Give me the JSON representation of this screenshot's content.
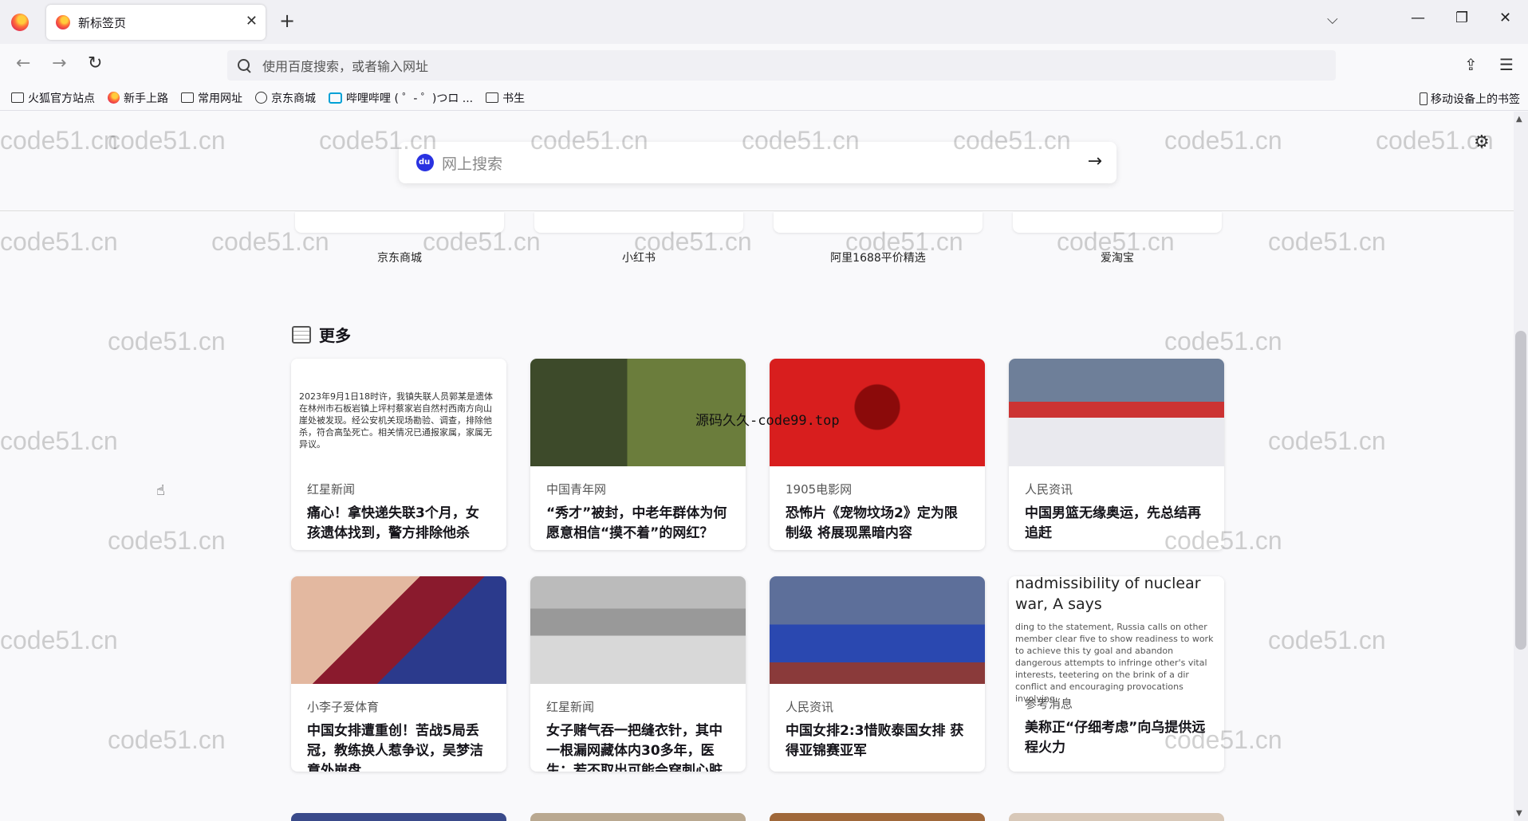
{
  "tab": {
    "title": "新标签页",
    "close": "✕"
  },
  "tabstrip": {
    "new_tab": "+",
    "tab_list": "⌵",
    "minimize": "—",
    "restore": "❐",
    "close": "✕"
  },
  "navbar": {
    "back": "←",
    "forward": "→",
    "reload": "↻",
    "url_placeholder": "使用百度搜索，或者输入网址",
    "extensions": "⇪",
    "menu": "☰"
  },
  "bookmarks": [
    {
      "label": "火狐官方站点",
      "icon": "folder-icon"
    },
    {
      "label": "新手上路",
      "icon": "firefox-icon"
    },
    {
      "label": "常用网址",
      "icon": "folder-icon"
    },
    {
      "label": "京东商城",
      "icon": "globe-icon"
    },
    {
      "label": "哔哩哔哩 ( ゜- ゜)つロ ...",
      "icon": "bilibili-icon"
    },
    {
      "label": "书生",
      "icon": "folder-icon"
    }
  ],
  "mobile_bookmarks": "移动设备上的书签",
  "search": {
    "placeholder": "网上搜索",
    "arrow": "→",
    "settings": "⚙"
  },
  "shortcuts": [
    "京东商城",
    "小红书",
    "阿里1688平价精选",
    "爱淘宝"
  ],
  "section_title": "更多",
  "cards": [
    {
      "source": "红星新闻",
      "title": "痛心！拿快递失联3个月，女孩遗体找到，警方排除他杀",
      "image_text": "2023年9月1日18时许，我镇失联人员郭某是遗体在林州市石板岩镇上坪村蔡家岩自然村西南方向山崖处被发现。经公安机关现场勘验、调查，排除他杀，符合高坠死亡。相关情况已通报家属，家属无异议。"
    },
    {
      "source": "中国青年网",
      "title": "“秀才”被封，中老年群体为何愿意相信“摸不着”的网红？"
    },
    {
      "source": "1905电影网",
      "title": "恐怖片《宠物坟场2》定为限制级 将展现黑暗内容"
    },
    {
      "source": "人民资讯",
      "title": "中国男篮无缘奥运，先总结再追赶"
    },
    {
      "source": "小李子爱体育",
      "title": "中国女排遭重创！苦战5局丢冠，教练换人惹争议，吴梦洁意外崩盘"
    },
    {
      "source": "红星新闻",
      "title": "女子赌气吞一把缝衣针，其中一根漏网藏体内30多年，医生：若不取出可能会穿刺心脏"
    },
    {
      "source": "人民资讯",
      "title": "中国女排2:3惜败泰国女排 获得亚锦赛亚军"
    },
    {
      "source": "参考消息",
      "title": "美称正“仔细考虑”向乌提供远程火力",
      "image_headline": "nadmissibility of nuclear war, A says",
      "image_text": "ding to the statement, Russia calls on other member clear five to show readiness to work to achieve this ty goal and abandon dangerous attempts to infringe other's vital interests, teetering on the brink of a dir conflict and encouraging provocations involving"
    }
  ],
  "watermark": "code51.cn",
  "overlay": "源码久久-code99.top"
}
